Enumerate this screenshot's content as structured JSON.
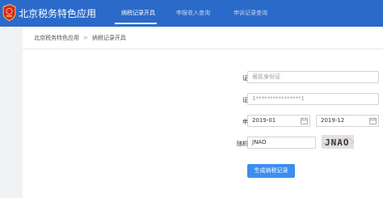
{
  "header": {
    "app_title": "北京税务特色应用",
    "nav": [
      {
        "label": "纳税记录开具",
        "active": true
      },
      {
        "label": "申报收入查询",
        "active": false
      },
      {
        "label": "申诉记录查询",
        "active": false
      }
    ],
    "brand_color": "#2a6ac9"
  },
  "breadcrumb": {
    "home": "北京税务特色应用",
    "separator": ">",
    "current": "纳税记录开具"
  },
  "form": {
    "id_type_label": "证件类型",
    "id_type_placeholder": "居民身份证",
    "id_number_label": "证件号码",
    "id_number_value": "1****************1",
    "date_label": "申报日期",
    "date_start": "2019-01",
    "date_end": "2019-12",
    "captcha_label": "随机验证码",
    "captcha_value": "JNAO",
    "captcha_image_text": "JNAO",
    "submit_label": "生成纳税记录",
    "accent_color": "#3b8ef0"
  }
}
